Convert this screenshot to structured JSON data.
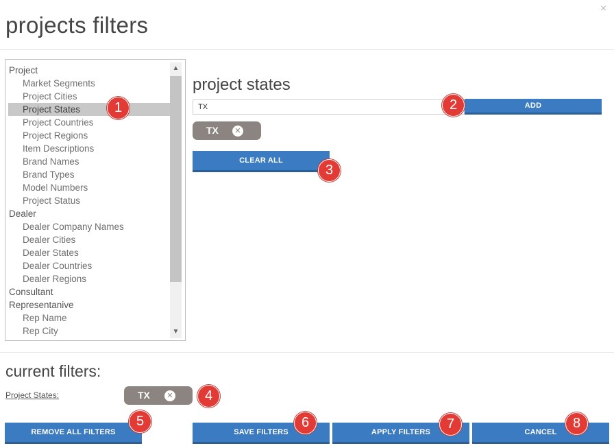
{
  "header": {
    "title": "projects filters",
    "close_glyph": "×",
    "close_icon": "close-icon"
  },
  "list": {
    "items": [
      {
        "label": "Project",
        "type": "group"
      },
      {
        "label": "Market Segments",
        "type": "sub"
      },
      {
        "label": "Project Cities",
        "type": "sub"
      },
      {
        "label": "Project States",
        "type": "sub",
        "selected": true
      },
      {
        "label": "Project Countries",
        "type": "sub"
      },
      {
        "label": "Project Regions",
        "type": "sub"
      },
      {
        "label": "Item Descriptions",
        "type": "sub"
      },
      {
        "label": "Brand Names",
        "type": "sub"
      },
      {
        "label": "Brand Types",
        "type": "sub"
      },
      {
        "label": "Model Numbers",
        "type": "sub"
      },
      {
        "label": "Project Status",
        "type": "sub"
      },
      {
        "label": "Dealer",
        "type": "group"
      },
      {
        "label": "Dealer Company Names",
        "type": "sub"
      },
      {
        "label": "Dealer Cities",
        "type": "sub"
      },
      {
        "label": "Dealer States",
        "type": "sub"
      },
      {
        "label": "Dealer Countries",
        "type": "sub"
      },
      {
        "label": "Dealer Regions",
        "type": "sub"
      },
      {
        "label": "Consultant",
        "type": "group"
      },
      {
        "label": "Representanive",
        "type": "group"
      },
      {
        "label": "Rep Name",
        "type": "sub"
      },
      {
        "label": "Rep City",
        "type": "sub"
      }
    ]
  },
  "panel": {
    "title": "project states",
    "input_value": "TX",
    "add_label": "ADD",
    "chip_label": "TX",
    "clear_all_label": "CLEAR ALL"
  },
  "current": {
    "title": "current filters:",
    "filter_name": "Project States:",
    "chip_label": "TX"
  },
  "footer": {
    "remove_all_label": "REMOVE ALL FILTERS",
    "save_label": "SAVE FILTERS",
    "apply_label": "APPLY FILTERS",
    "cancel_label": "CANCEL"
  },
  "badges": [
    "1",
    "2",
    "3",
    "4",
    "5",
    "6",
    "7",
    "8"
  ],
  "colors": {
    "button": "#3a7bc1",
    "chip": "#8c8480",
    "badge": "#e23b36",
    "selected_row": "#c8c8c8"
  }
}
